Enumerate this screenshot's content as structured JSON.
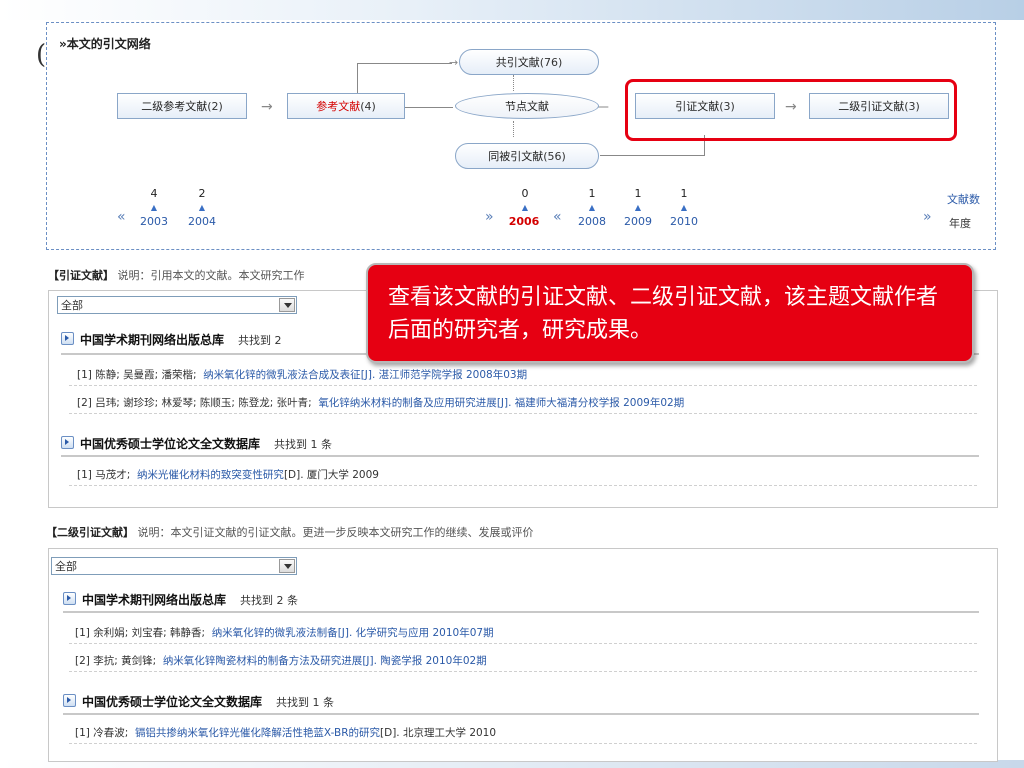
{
  "network": {
    "title": "»本文的引文网络",
    "nodes": {
      "co_cite": {
        "label": "共引文献",
        "count": "(76)"
      },
      "second_ref": {
        "label": "二级参考文献",
        "count": "(2)"
      },
      "ref": {
        "label": "参考文献",
        "count": "(4)"
      },
      "center": {
        "label": "节点文献"
      },
      "cited": {
        "label": "引证文献",
        "count": "(3)"
      },
      "second_cited": {
        "label": "二级引证文献",
        "count": "(3)"
      },
      "co_cited": {
        "label": "同被引文献",
        "count": "(56)"
      }
    },
    "timeline": {
      "left_nav": "«",
      "right_nav": "»",
      "mid_nav_left": "»",
      "mid_nav_right": "«",
      "counts_label": "文献数",
      "years_label": "年度",
      "left_group": [
        {
          "count": "4",
          "year": "2003"
        },
        {
          "count": "2",
          "year": "2004"
        }
      ],
      "right_group": [
        {
          "count": "0",
          "year": "2006",
          "active": true
        },
        {
          "count": "1",
          "year": "2008"
        },
        {
          "count": "1",
          "year": "2009"
        },
        {
          "count": "1",
          "year": "2010"
        }
      ]
    }
  },
  "cited_section": {
    "header_bold": "【引证文献】",
    "header_desc": "说明：引用本文的文献。本文研究工作",
    "select_value": "全部",
    "groups": [
      {
        "name": "中国学术期刊网络出版总库",
        "count_text": "共找到 2",
        "items": [
          {
            "prefix": "[1] 陈静; 吴曼霞; 潘荣楷;",
            "title": "纳米氧化锌的微乳液法合成及表征",
            "suffix": "[J]. 湛江师范学院学报  2008年03期"
          },
          {
            "prefix": "[2] 吕玮; 谢珍珍; 林爱琴; 陈顺玉; 陈登龙; 张叶青;",
            "title": "氧化锌纳米材料的制备及应用研究进展",
            "suffix": "[J]. 福建师大福清分校学报  2009年02期"
          }
        ]
      },
      {
        "name": "中国优秀硕士学位论文全文数据库",
        "count_text": "共找到 1 条",
        "items": [
          {
            "prefix": "[1] 马茂才;",
            "title": "纳米光催化材料的致突变性研究",
            "suffix": "[D]. 厦门大学  2009"
          }
        ]
      }
    ]
  },
  "second_section": {
    "header_bold": "【二级引证文献】",
    "header_desc": "说明：本文引证文献的引证文献。更进一步反映本文研究工作的继续、发展或评价",
    "select_value": "全部",
    "groups": [
      {
        "name": "中国学术期刊网络出版总库",
        "count_text": "共找到 2 条",
        "items": [
          {
            "prefix": "[1] 余利娟; 刘宝春; 韩静香;",
            "title": "纳米氧化锌的微乳液法制备",
            "suffix": "[J]. 化学研究与应用  2010年07期"
          },
          {
            "prefix": "[2] 李抗; 黄剑锋;",
            "title": "纳米氧化锌陶瓷材料的制备方法及研究进展",
            "suffix": "[J]. 陶瓷学报  2010年02期"
          }
        ]
      },
      {
        "name": "中国优秀硕士学位论文全文数据库",
        "count_text": "共找到 1 条",
        "items": [
          {
            "prefix": "[1] 冷春波;",
            "title": "镉铝共掺纳米氧化锌光催化降解活性艳蓝X-BR的研究",
            "suffix": "[D]. 北京理工大学  2010"
          }
        ]
      }
    ]
  },
  "callout": {
    "text": "查看该文献的引证文献、二级引证文献，该主题文献作者后面的研究者，研究成果。"
  },
  "colors": {
    "highlight": "#e60012",
    "link": "#2b5aa8",
    "active": "#d40000"
  }
}
